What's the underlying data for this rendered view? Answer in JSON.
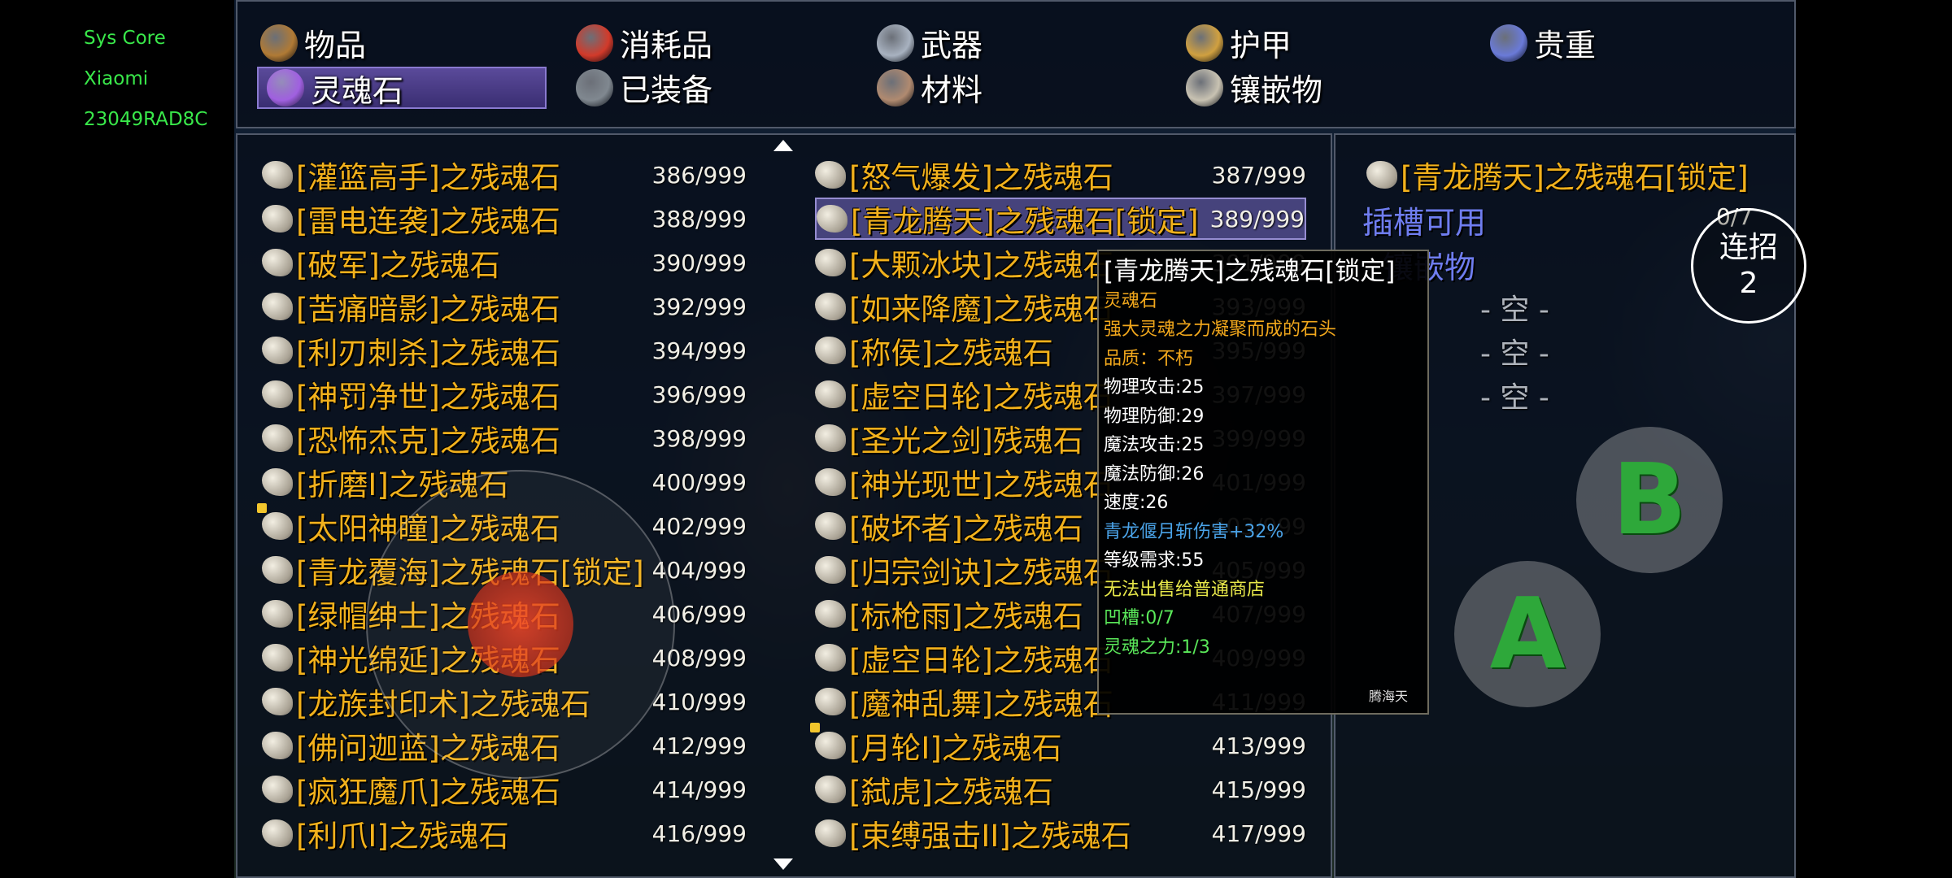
{
  "device": {
    "app_name": "Sys Core",
    "brand": "Xiaomi",
    "model": "23049RAD8C"
  },
  "tabs": [
    {
      "label": "物品",
      "icon": "bag-icon",
      "color": "#b07a35"
    },
    {
      "label": "消耗品",
      "icon": "potion-icon",
      "color": "#d23a2a"
    },
    {
      "label": "武器",
      "icon": "sword-icon",
      "color": "#a8b2c0"
    },
    {
      "label": "护甲",
      "icon": "armor-icon",
      "color": "#d0a040"
    },
    {
      "label": "贵重",
      "icon": "chest-icon",
      "color": "#6a7ad8"
    },
    {
      "label": "灵魂石",
      "icon": "soul-orb-icon",
      "color": "#a060e0",
      "selected": true
    },
    {
      "label": "已装备",
      "icon": "equipped-icon",
      "color": "#808890"
    },
    {
      "label": "材料",
      "icon": "material-icon",
      "color": "#b08a70"
    },
    {
      "label": "镶嵌物",
      "icon": "gem-stone-icon",
      "color": "#c8c2b2"
    }
  ],
  "list_left": [
    {
      "name": "[灌篮高手]之残魂石",
      "count": "386/999"
    },
    {
      "name": "[雷电连袭]之残魂石",
      "count": "388/999"
    },
    {
      "name": "[破军]之残魂石",
      "count": "390/999"
    },
    {
      "name": "[苦痛暗影]之残魂石",
      "count": "392/999"
    },
    {
      "name": "[利刃刺杀]之残魂石",
      "count": "394/999"
    },
    {
      "name": "[神罚净世]之残魂石",
      "count": "396/999"
    },
    {
      "name": "[恐怖杰克]之残魂石",
      "count": "398/999"
    },
    {
      "name": "[折磨I]之残魂石",
      "count": "400/999"
    },
    {
      "name": "[太阳神瞳]之残魂石",
      "count": "402/999",
      "new": true
    },
    {
      "name": "[青龙覆海]之残魂石[锁定]",
      "count": "404/999"
    },
    {
      "name": "[绿帽绅士]之残魂石",
      "count": "406/999"
    },
    {
      "name": "[神光绵延]之残魂石",
      "count": "408/999"
    },
    {
      "name": "[龙族封印术]之残魂石",
      "count": "410/999"
    },
    {
      "name": "[佛问迦蓝]之残魂石",
      "count": "412/999"
    },
    {
      "name": "[疯狂魔爪]之残魂石",
      "count": "414/999"
    },
    {
      "name": "[利爪I]之残魂石",
      "count": "416/999"
    }
  ],
  "list_right": [
    {
      "name": "[怒气爆发]之残魂石",
      "count": "387/999"
    },
    {
      "name": "[青龙腾天]之残魂石[锁定]",
      "count": "389/999",
      "selected": true
    },
    {
      "name": "[大颗冰块]之残魂石",
      "count": "391/999"
    },
    {
      "name": "[如来降魔]之残魂石",
      "count": "393/999"
    },
    {
      "name": "[称侯]之残魂石",
      "count": "395/999"
    },
    {
      "name": "[虚空日轮]之残魂石",
      "count": "397/999"
    },
    {
      "name": "[圣光之剑]残魂石",
      "count": "399/999"
    },
    {
      "name": "[神光现世]之残魂石",
      "count": "401/999"
    },
    {
      "name": "[破坏者]之残魂石",
      "count": "403/999"
    },
    {
      "name": "[归宗剑诀]之残魂石",
      "count": "405/999"
    },
    {
      "name": "[标枪雨]之残魂石",
      "count": "407/999"
    },
    {
      "name": "[虚空日轮]之残魂石",
      "count": "409/999"
    },
    {
      "name": "[魔神乱舞]之残魂石",
      "count": "411/999"
    },
    {
      "name": "[月轮I]之残魂石",
      "count": "413/999",
      "new": true
    },
    {
      "name": "[弑虎]之残魂石",
      "count": "415/999"
    },
    {
      "name": "[束缚强击II]之残魂石",
      "count": "417/999"
    }
  ],
  "detail": {
    "title": "[青龙腾天]之残魂石[锁定]",
    "socket_available": "插槽可用",
    "socket_count": "0/7",
    "inlay_label": "镶嵌物",
    "empty_slots": [
      "- 空 -",
      "- 空 -",
      "- 空 -"
    ]
  },
  "tooltip": {
    "title": "[青龙腾天]之残魂石[锁定]",
    "lines": [
      {
        "text": "灵魂石",
        "color": "#f2a81c"
      },
      {
        "text": "强大灵魂之力凝聚而成的石头",
        "color": "#f2a81c"
      },
      {
        "text": "品质：不朽",
        "color": "#f2a81c"
      },
      {
        "text": "物理攻击:25",
        "color": "#ffffff"
      },
      {
        "text": "物理防御:29",
        "color": "#ffffff"
      },
      {
        "text": "魔法攻击:25",
        "color": "#ffffff"
      },
      {
        "text": "魔法防御:26",
        "color": "#ffffff"
      },
      {
        "text": "速度:26",
        "color": "#ffffff"
      },
      {
        "text": "青龙偃月斩伤害+32%",
        "color": "#4aa3e8"
      },
      {
        "text": "等级需求:55",
        "color": "#ffffff"
      },
      {
        "text": "无法出售给普通商店",
        "color": "#e8e84a"
      },
      {
        "text": "凹槽:0/7",
        "color": "#5ae85a"
      },
      {
        "text": "灵魂之力:1/3",
        "color": "#5ae85a"
      }
    ],
    "footer": "腾海天"
  },
  "controls": {
    "combo_label": "连招",
    "combo_count": "2",
    "btn_a": "A",
    "btn_b": "B"
  }
}
